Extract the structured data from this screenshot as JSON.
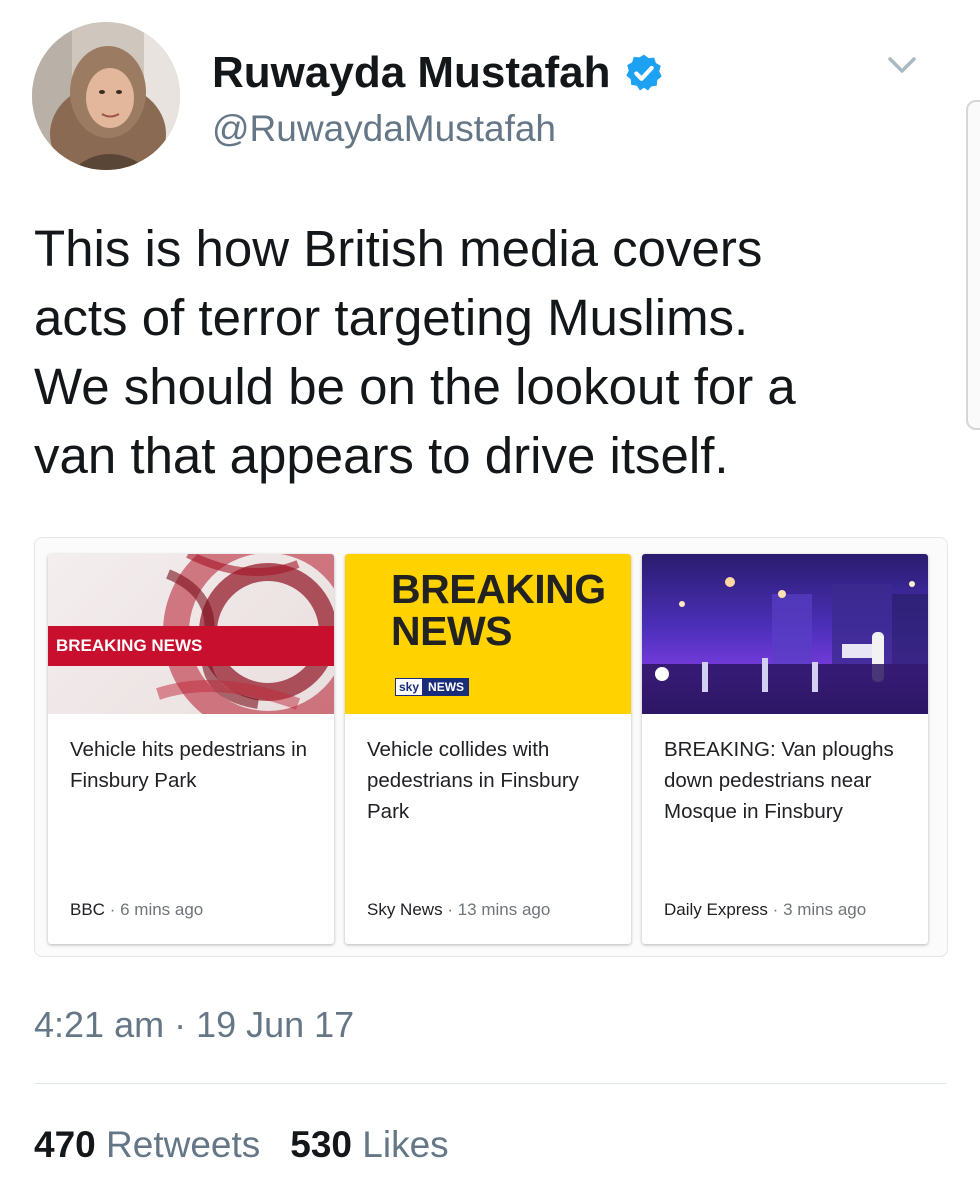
{
  "tweet": {
    "author": {
      "display_name": "Ruwayda Mustafah",
      "handle": "@RuwaydaMustafah",
      "verified": true,
      "avatar_icon": "profile-photo"
    },
    "text_lines": [
      "This is how British media covers",
      "acts of terror targeting Muslims.",
      "We should be on the lookout for a",
      "van that appears to drive itself."
    ],
    "timestamp": "4:21 am · 19 Jun 17",
    "stats": {
      "retweets_count": "470",
      "retweets_label": "Retweets",
      "likes_count": "530",
      "likes_label": "Likes"
    }
  },
  "news_cards": [
    {
      "thumb_label": "BREAKING NEWS",
      "headline": "Vehicle hits pedestrians in Finsbury Park",
      "source": "BBC",
      "separator": "·",
      "age": "6 mins ago"
    },
    {
      "thumb_title": "BREAKING NEWS",
      "thumb_logo_sky": "sky",
      "thumb_logo_news": "NEWS",
      "headline": "Vehicle collides with pedestrians in Finsbury Park",
      "source": "Sky News",
      "separator": "·",
      "age": "13 mins ago"
    },
    {
      "headline": "BREAKING: Van ploughs down pedestrians near Mosque in Finsbury",
      "source": "Daily Express",
      "separator": "·",
      "age": "3 mins ago"
    }
  ],
  "colors": {
    "verified_blue": "#1da1f2",
    "secondary_text": "#657786",
    "primary_text": "#14171a",
    "bbc_red": "#c8102e",
    "sky_yellow": "#ffd200"
  }
}
